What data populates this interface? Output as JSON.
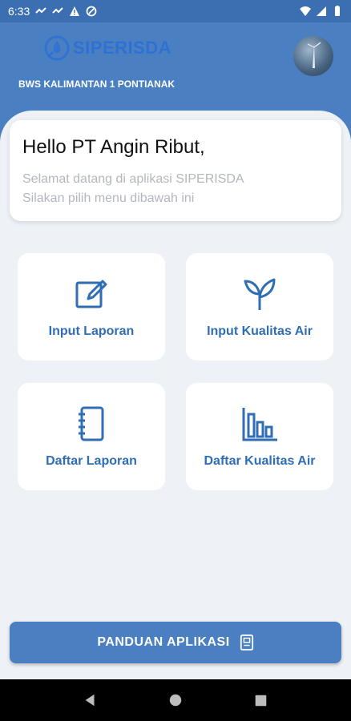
{
  "status_bar": {
    "time": "6:33"
  },
  "header": {
    "app_name": "SIPERISDA",
    "org_name": "BWS KALIMANTAN 1 PONTIANAK"
  },
  "greeting": {
    "title": "Hello PT Angin Ribut,",
    "line1": "Selamat datang di aplikasi SIPERISDA",
    "line2": "Silakan pilih menu dibawah ini"
  },
  "menu": {
    "input_laporan": "Input Laporan",
    "input_kualitas_air": "Input Kualitas Air",
    "daftar_laporan": "Daftar Laporan",
    "daftar_kualitas_air": "Daftar Kualitas Air"
  },
  "guide_button": {
    "label": "PANDUAN APLIKASI"
  },
  "colors": {
    "primary": "#4a7fc1",
    "accent_text": "#2f6db5",
    "background": "#eef2f7"
  }
}
